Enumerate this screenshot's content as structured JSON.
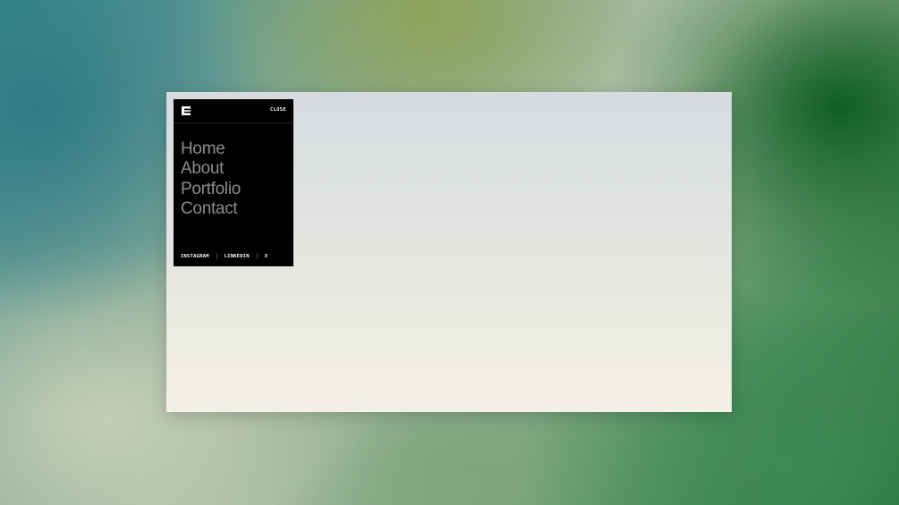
{
  "menu": {
    "close_label": "CLOSE",
    "nav_items": [
      {
        "label": "Home"
      },
      {
        "label": "About"
      },
      {
        "label": "Portfolio"
      },
      {
        "label": "Contact"
      }
    ],
    "social_links": [
      {
        "label": "INSTAGRAM"
      },
      {
        "label": "LINKEDIN"
      },
      {
        "label": "X"
      }
    ]
  },
  "colors": {
    "panel_bg": "#000000",
    "nav_text": "#8c8c8c",
    "window_top": "#d6dbe0",
    "window_bottom": "#f3f0e6"
  },
  "icons": {
    "logo": "brand-logo-icon"
  }
}
